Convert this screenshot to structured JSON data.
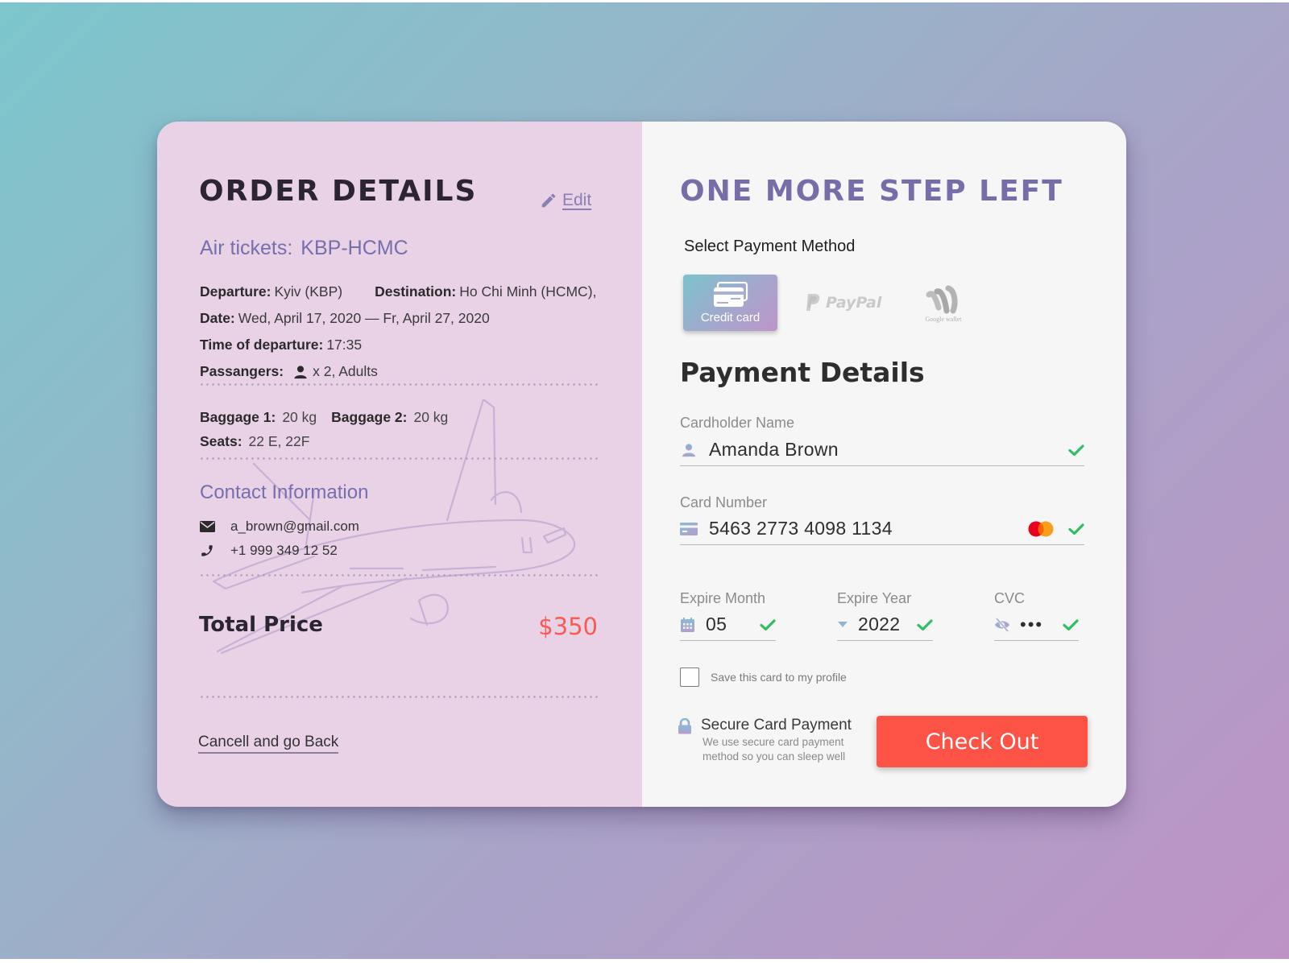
{
  "colors": {
    "accent_purple": "#766fae",
    "price_red": "#f75b51",
    "checkout_red": "#fd5246",
    "check_green": "#2fbf63",
    "left_panel_bg": "#ead2e6",
    "right_panel_bg": "#f6f6f6"
  },
  "order": {
    "title": "ORDER DETAILS",
    "edit_label": "Edit",
    "air_tickets_label": "Air tickets:",
    "air_tickets_route": "KBP-HCMC",
    "departure_label": "Departure:",
    "departure_value": "Kyiv (KBP)",
    "destination_label": "Destination:",
    "destination_value": "Ho Chi Minh (HCMC),",
    "date_label": "Date:",
    "date_value": "Wed, April 17, 2020 — Fr, April 27, 2020",
    "time_label": "Time of departure:",
    "time_value": "17:35",
    "passengers_label": "Passangers:",
    "passengers_value": "x 2, Adults",
    "baggage1_label": "Baggage 1:",
    "baggage1_value": "20 kg",
    "baggage2_label": "Baggage 2:",
    "baggage2_value": "20 kg",
    "seats_label": "Seats:",
    "seats_value": "22 E, 22F",
    "contact_title": "Contact Information",
    "email": "a_brown@gmail.com",
    "phone": "+1 999 349 12 52",
    "total_label": "Total Price",
    "total_value": "$350",
    "cancel_label": "Cancell and go Back"
  },
  "payment": {
    "title": "ONE MORE STEP LEFT",
    "select_method_label": "Select Payment Method",
    "methods": [
      {
        "name": "Credit card",
        "icon": "credit-card-icon",
        "selected": true
      },
      {
        "name": "PayPal",
        "icon": "paypal-logo",
        "selected": false
      },
      {
        "name": "Google wallet",
        "icon": "google-wallet-logo",
        "selected": false
      }
    ],
    "details_title": "Payment Details",
    "cardholder_label": "Cardholder Name",
    "cardholder_value": "Amanda Brown",
    "card_number_label": "Card Number",
    "card_number_value": "5463 2773 4098 1134",
    "card_brand": "mastercard",
    "expire_month_label": "Expire Month",
    "expire_month_value": "05",
    "expire_year_label": "Expire Year",
    "expire_year_value": "2022",
    "cvc_label": "CVC",
    "cvc_value": "•••",
    "save_card_label": "Save this card to my profile",
    "save_card_checked": false,
    "secure_title": "Secure Card Payment",
    "secure_line1": "We use secure card payment",
    "secure_line2": "method so you can sleep well",
    "checkout_label": "Check Out"
  }
}
